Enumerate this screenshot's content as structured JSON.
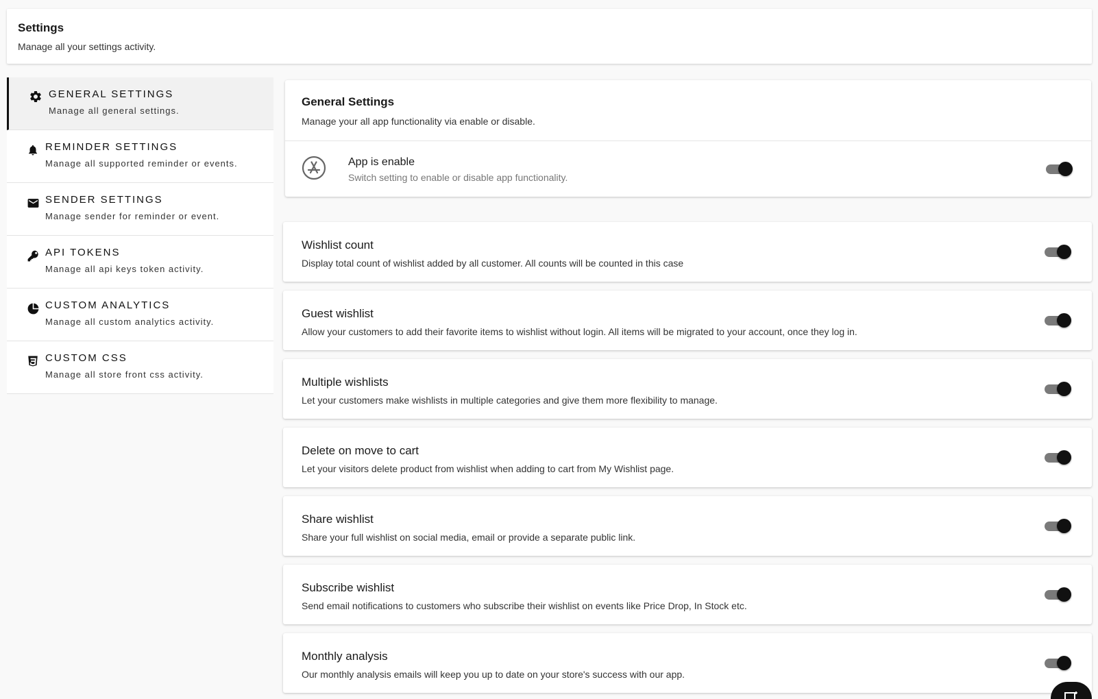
{
  "header": {
    "title": "Settings",
    "subtitle": "Manage all your settings activity."
  },
  "sidebar": {
    "items": [
      {
        "title": "GENERAL SETTINGS",
        "subtitle": "Manage all general settings.",
        "icon": "gear-icon",
        "active": true
      },
      {
        "title": "REMINDER SETTINGS",
        "subtitle": "Manage all supported reminder or events.",
        "icon": "bell-icon"
      },
      {
        "title": "SENDER SETTINGS",
        "subtitle": "Manage sender for reminder or event.",
        "icon": "envelope-icon"
      },
      {
        "title": "API TOKENS",
        "subtitle": "Manage all api keys token activity.",
        "icon": "key-icon"
      },
      {
        "title": "CUSTOM ANALYTICS",
        "subtitle": "Manage all custom analytics activity.",
        "icon": "pie-chart-icon"
      },
      {
        "title": "CUSTOM CSS",
        "subtitle": "Manage all store front css activity.",
        "icon": "css3-icon"
      }
    ]
  },
  "general": {
    "title": "General Settings",
    "subtitle": "Manage your all app functionality via enable or disable.",
    "app": {
      "title": "App is enable",
      "subtitle": "Switch setting to enable or disable app functionality.",
      "enabled": true
    }
  },
  "features": [
    {
      "title": "Wishlist count",
      "description": "Display total count of wishlist added by all customer. All counts will be counted in this case",
      "enabled": true
    },
    {
      "title": "Guest wishlist",
      "description": "Allow your customers to add their favorite items to wishlist without login. All items will be migrated to your account, once they log in.",
      "enabled": true
    },
    {
      "title": "Multiple wishlists",
      "description": "Let your customers make wishlists in multiple categories and give them more flexibility to manage.",
      "enabled": true
    },
    {
      "title": "Delete on move to cart",
      "description": "Let your visitors delete product from wishlist when adding to cart from My Wishlist page.",
      "enabled": true
    },
    {
      "title": "Share wishlist",
      "description": "Share your full wishlist on social media, email or provide a separate public link.",
      "enabled": true
    },
    {
      "title": "Subscribe wishlist",
      "description": "Send email notifications to customers who subscribe their wishlist on events like Price Drop, In Stock etc.",
      "enabled": true
    },
    {
      "title": "Monthly analysis",
      "description": "Our monthly analysis emails will keep you up to date on your store's success with our app.",
      "enabled": true
    }
  ],
  "colors": {
    "background": "#f9f9f9",
    "accent": "#111111",
    "toggle_track": "#7a7a7a"
  }
}
